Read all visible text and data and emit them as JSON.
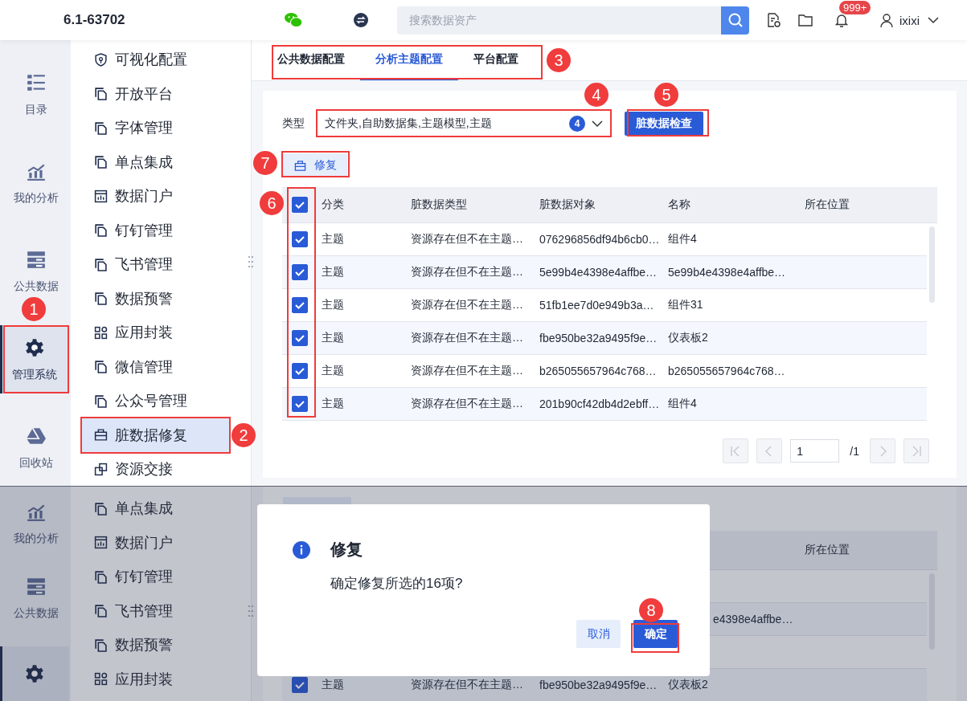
{
  "header": {
    "version": "6.1-63702",
    "search": {
      "placeholder": "搜索数据资产"
    },
    "notification_badge": "999+",
    "user": "ixixi"
  },
  "top_screen": {
    "nav": [
      {
        "label": "目录",
        "kind": "catalog",
        "selected": false
      },
      {
        "label": "我的分析",
        "kind": "analysis",
        "selected": false
      },
      {
        "label": "公共数据",
        "kind": "data",
        "selected": false
      },
      {
        "label": "管理系统",
        "kind": "admin",
        "selected": true
      },
      {
        "label": "回收站",
        "kind": "recycle",
        "selected": false
      }
    ],
    "menu": [
      {
        "label": "可视化配置",
        "kind": "shield",
        "selected": false
      },
      {
        "label": "开放平台",
        "kind": "copy",
        "selected": false
      },
      {
        "label": "字体管理",
        "kind": "copy",
        "selected": false
      },
      {
        "label": "单点集成",
        "kind": "copy",
        "selected": false
      },
      {
        "label": "数据门户",
        "kind": "chart",
        "selected": false
      },
      {
        "label": "钉钉管理",
        "kind": "copy",
        "selected": false
      },
      {
        "label": "飞书管理",
        "kind": "copy",
        "selected": false
      },
      {
        "label": "数据预警",
        "kind": "copy",
        "selected": false
      },
      {
        "label": "应用封装",
        "kind": "grid",
        "selected": false
      },
      {
        "label": "微信管理",
        "kind": "copy",
        "selected": false
      },
      {
        "label": "公众号管理",
        "kind": "copy",
        "selected": false
      },
      {
        "label": "脏数据修复",
        "kind": "repair",
        "selected": true
      },
      {
        "label": "资源交接",
        "kind": "exchange",
        "selected": false
      }
    ],
    "tabs": [
      {
        "label": "公共数据配置",
        "selected": false
      },
      {
        "label": "分析主题配置",
        "selected": true
      },
      {
        "label": "平台配置",
        "selected": false
      }
    ],
    "filter": {
      "label": "类型",
      "value": "文件夹,自助数据集,主题模型,主题",
      "count": "4"
    },
    "check_button": "脏数据检查",
    "repair_button": "修复",
    "table": {
      "columns": [
        "分类",
        "脏数据类型",
        "脏数据对象",
        "名称",
        "所在位置"
      ],
      "all_checked": true,
      "rows": [
        {
          "checked": true,
          "cells": [
            "主题",
            "资源存在但不在主题…",
            "076296856df94b6cb0…",
            "组件4"
          ]
        },
        {
          "checked": true,
          "cells": [
            "主题",
            "资源存在但不在主题…",
            "5e99b4e4398e4affbe…",
            "5e99b4e4398e4affbe…"
          ]
        },
        {
          "checked": true,
          "cells": [
            "主题",
            "资源存在但不在主题…",
            "51fb1ee7d0e949b3a…",
            "组件31"
          ]
        },
        {
          "checked": true,
          "cells": [
            "主题",
            "资源存在但不在主题…",
            "fbe950be32a9495f9e…",
            "仪表板2"
          ]
        },
        {
          "checked": true,
          "cells": [
            "主题",
            "资源存在但不在主题…",
            "b265055657964c768…",
            "b265055657964c768…"
          ]
        },
        {
          "checked": true,
          "cells": [
            "主题",
            "资源存在但不在主题…",
            "201b90cf42db4d2ebff…",
            "组件4"
          ]
        }
      ]
    },
    "pagination": {
      "page": "1",
      "total": "/1"
    }
  },
  "bottom_screen": {
    "nav": [
      {
        "label": "我的分析",
        "kind": "analysis",
        "selected": false
      },
      {
        "label": "公共数据",
        "kind": "data",
        "selected": false
      },
      {
        "kind": "admin",
        "selected": true
      }
    ],
    "menu": [
      {
        "label": "单点集成",
        "kind": "copy",
        "selected": false
      },
      {
        "label": "数据门户",
        "kind": "chart",
        "selected": false
      },
      {
        "label": "钉钉管理",
        "kind": "copy",
        "selected": false
      },
      {
        "label": "飞书管理",
        "kind": "copy",
        "selected": false
      },
      {
        "label": "数据预警",
        "kind": "copy",
        "selected": false
      },
      {
        "label": "应用封装",
        "kind": "grid",
        "selected": false
      }
    ],
    "table": {
      "column": "所在位置",
      "partial_name": "e4398e4affbe…",
      "row": {
        "checked": true,
        "cells": [
          "主题",
          "资源存在但不在主题…",
          "fbe950be32a9495f9e…",
          "仪表板2"
        ]
      }
    },
    "dialog": {
      "title": "修复",
      "message": "确定修复所选的16项?",
      "buttons": [
        {
          "label": "取消",
          "kind": "secondary"
        },
        {
          "label": "确定",
          "kind": "primary"
        }
      ]
    }
  },
  "callouts": [
    {
      "number": "1"
    },
    {
      "number": "2"
    },
    {
      "number": "3"
    },
    {
      "number": "4"
    },
    {
      "number": "5"
    },
    {
      "number": "6"
    },
    {
      "number": "7"
    },
    {
      "number": "8"
    }
  ]
}
